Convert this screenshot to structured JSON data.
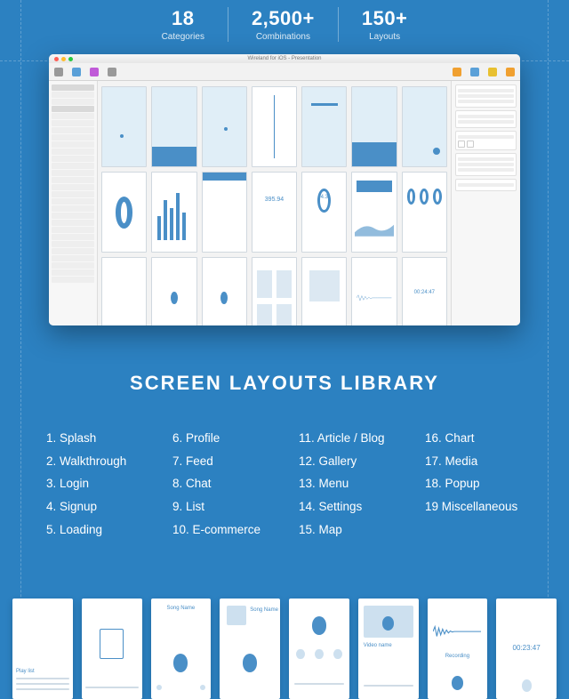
{
  "stats": [
    {
      "num": "18",
      "lbl": "Categories"
    },
    {
      "num": "2,500+",
      "lbl": "Combinations"
    },
    {
      "num": "150+",
      "lbl": "Layouts"
    }
  ],
  "app": {
    "title": "Wireland for iOS - Presentation"
  },
  "library": {
    "title": "SCREEN LAYOUTS LIBRARY",
    "cols": [
      [
        "1. Splash",
        "2. Walkthrough",
        "3. Login",
        "4. Signup",
        "5. Loading"
      ],
      [
        "6. Profile",
        "7. Feed",
        "8. Chat",
        "9. List",
        "10. E-commerce"
      ],
      [
        "11. Article / Blog",
        "12. Gallery",
        "13. Menu",
        "14. Settings",
        "15. Map"
      ],
      [
        "16. Chart",
        "17. Media",
        "18. Popup",
        "19 Miscellaneous"
      ]
    ]
  },
  "strip": {
    "cards": [
      {
        "label": "Play list"
      },
      {
        "label": ""
      },
      {
        "label": "Song Name"
      },
      {
        "label": "Song Name"
      },
      {
        "label": ""
      },
      {
        "label": "Video name"
      },
      {
        "label": "Recording"
      },
      {
        "label": "00:23:47"
      }
    ]
  }
}
